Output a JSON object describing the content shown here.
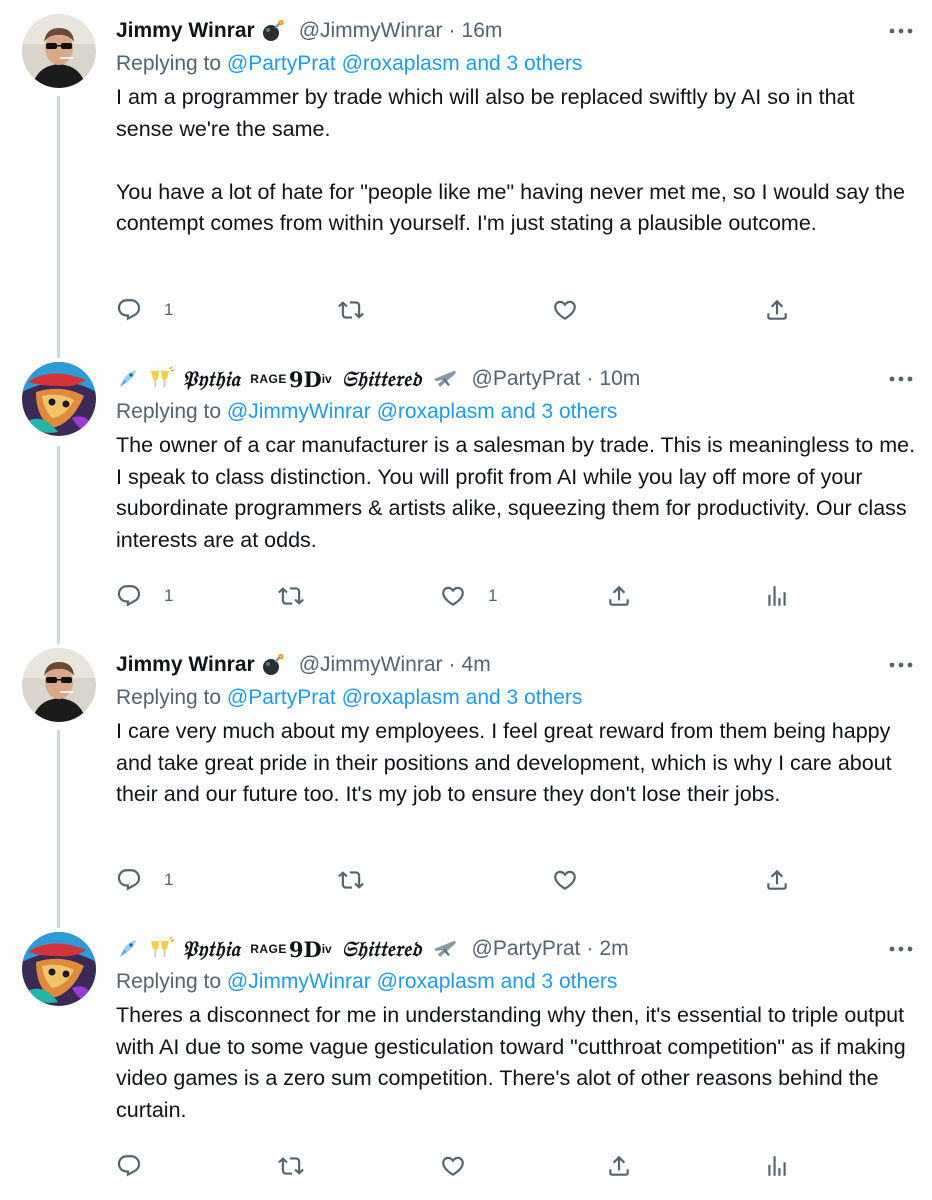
{
  "tweets": [
    {
      "display_name": "Jimmy Winrar",
      "handle": "@JimmyWinrar",
      "time": "16m",
      "replying_prefix": "Replying to",
      "replying_to": [
        "@PartyPrat",
        "@roxaplasm"
      ],
      "replying_others": "and 3 others",
      "paragraphs": [
        "I am a programmer by trade which will also be replaced swiftly by AI so in that sense we're the same.",
        "You have a lot of hate for \"people like me\" having never met me, so I would say the contempt comes from within yourself. I'm just stating a plausible outcome."
      ],
      "reply_count": "1",
      "retweet_count": "",
      "like_count": ""
    },
    {
      "display_name_main": "𝔓𝔶𝔱𝔥𝔦𝔞",
      "display_name_rage": "RAGE",
      "display_name_mid": "9D",
      "display_name_sub": "iv",
      "display_name_tail": "𝔖𝔥𝔦𝔱𝔱𝔢𝔯𝔢𝔡",
      "handle": "@PartyPrat",
      "time": "10m",
      "replying_prefix": "Replying to",
      "replying_to": [
        "@JimmyWinrar",
        "@roxaplasm"
      ],
      "replying_others": "and 3 others",
      "paragraphs": [
        "The owner of a car manufacturer is a salesman by trade. This is meaningless to me. I speak to class distinction. You will profit from AI while you lay off more of your subordinate programmers & artists alike, squeezing them for productivity. Our class interests are at odds."
      ],
      "reply_count": "1",
      "retweet_count": "",
      "like_count": "1"
    },
    {
      "display_name": "Jimmy Winrar",
      "handle": "@JimmyWinrar",
      "time": "4m",
      "replying_prefix": "Replying to",
      "replying_to": [
        "@PartyPrat",
        "@roxaplasm"
      ],
      "replying_others": "and 3 others",
      "paragraphs": [
        "I care very much about my employees. I feel great reward from them being happy and take great pride in their positions and development, which is why I care about their and our future too. It's my job to ensure they don't lose their jobs."
      ],
      "reply_count": "1",
      "retweet_count": "",
      "like_count": ""
    },
    {
      "display_name_main": "𝔓𝔶𝔱𝔥𝔦𝔞",
      "display_name_rage": "RAGE",
      "display_name_mid": "9D",
      "display_name_sub": "iv",
      "display_name_tail": "𝔖𝔥𝔦𝔱𝔱𝔢𝔯𝔢𝔡",
      "handle": "@PartyPrat",
      "time": "2m",
      "replying_prefix": "Replying to",
      "replying_to": [
        "@JimmyWinrar",
        "@roxaplasm"
      ],
      "replying_others": "and 3 others",
      "paragraphs": [
        "Theres a disconnect for me in understanding why then, it's essential to triple output with AI due to some vague gesticulation toward \"cutthroat competition\" as if making video games is a zero sum competition. There's alot of other reasons behind the curtain."
      ],
      "reply_count": "",
      "retweet_count": "",
      "like_count": ""
    }
  ],
  "dot_separator": "·",
  "icons": {
    "reply": "reply-icon",
    "retweet": "retweet-icon",
    "like": "like-icon",
    "share": "share-icon",
    "analytics": "analytics-icon",
    "more": "more-icon",
    "bomb": "bomb-emoji-icon",
    "rocket": "rocket-emoji-icon",
    "cheers": "cheers-emoji-icon",
    "airplane": "airplane-emoji-icon"
  },
  "colors": {
    "link": "#1d9bf0",
    "secondary": "#536471",
    "text": "#0f1419",
    "thread_line": "#cfd9de"
  }
}
